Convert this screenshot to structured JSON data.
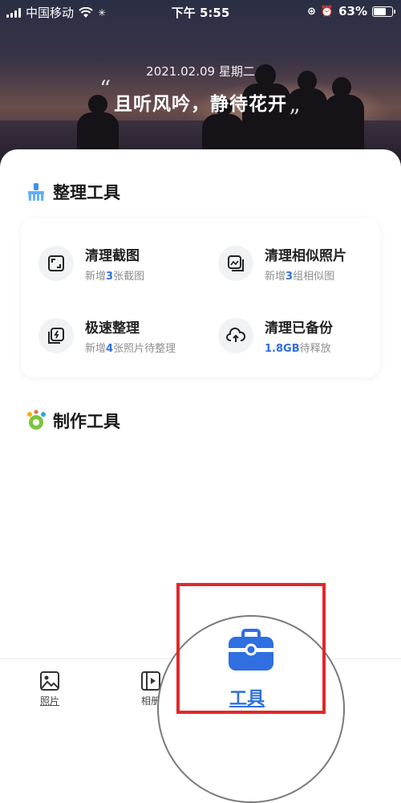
{
  "status_bar": {
    "carrier": "中国移动",
    "time": "下午 5:55",
    "battery": "63%",
    "battery_level": 0.63
  },
  "hero": {
    "date": "2021.02.09  星期二",
    "quote": "且听风吟，静待花开",
    "quote_open": "“",
    "quote_close": "”"
  },
  "sections": {
    "organize_title": "整理工具",
    "make_title": "制作工具"
  },
  "tools": [
    {
      "name": "清理截图",
      "prefix": "新增",
      "count": "3",
      "suffix": "张截图",
      "icon": "screenshot-icon"
    },
    {
      "name": "清理相似照片",
      "prefix": "新增",
      "count": "3",
      "suffix": "组相似图",
      "icon": "similar-photos-icon"
    },
    {
      "name": "极速整理",
      "prefix": "新增",
      "count": "4",
      "suffix": "张照片待整理",
      "icon": "quick-organize-icon"
    },
    {
      "name": "清理已备份",
      "prefix": "",
      "count": "1.8GB",
      "suffix": "待释放",
      "icon": "cloud-upload-icon"
    }
  ],
  "tabbar": {
    "photos": "照片",
    "albums": "相册",
    "tools": "工具"
  },
  "colors": {
    "accent": "#2f6fe0",
    "highlight_box": "#e3262a"
  }
}
